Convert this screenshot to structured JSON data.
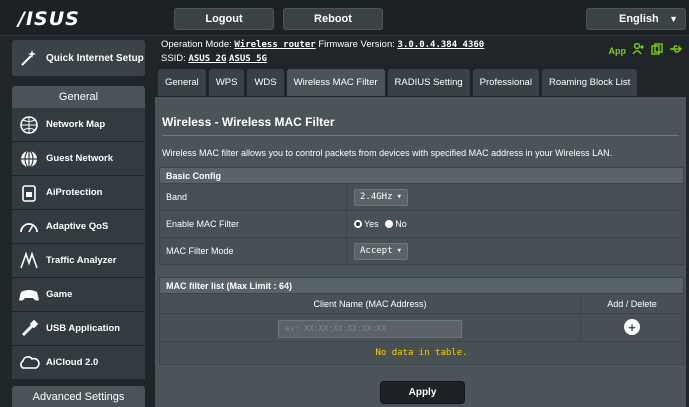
{
  "brand": {
    "logo": "/ISUS"
  },
  "topbar": {
    "logout": "Logout",
    "reboot": "Reboot",
    "language": "English"
  },
  "sidebar": {
    "quick_setup": "Quick Internet Setup",
    "general_header": "General",
    "items": [
      {
        "label": "Network Map",
        "icon": "network-map-icon"
      },
      {
        "label": "Guest Network",
        "icon": "globe-icon"
      },
      {
        "label": "AiProtection",
        "icon": "lock-icon"
      },
      {
        "label": "Adaptive QoS",
        "icon": "gauge-icon"
      },
      {
        "label": "Traffic Analyzer",
        "icon": "traffic-icon"
      },
      {
        "label": "Game",
        "icon": "gamepad-icon"
      },
      {
        "label": "USB Application",
        "icon": "usb-icon"
      },
      {
        "label": "AiCloud 2.0",
        "icon": "cloud-icon"
      }
    ],
    "advanced_header": "Advanced Settings"
  },
  "status": {
    "mode_label": "Operation Mode:",
    "mode_value": "Wireless router",
    "fw_label": "Firmware Version:",
    "fw_value": "3.0.0.4.384_4360",
    "ssid_label": "SSID:",
    "ssid_2g": "ASUS_2G",
    "ssid_5g": "ASUS_5G",
    "app_label": "App"
  },
  "tabs": [
    "General",
    "WPS",
    "WDS",
    "Wireless MAC Filter",
    "RADIUS Setting",
    "Professional",
    "Roaming Block List"
  ],
  "main": {
    "title": "Wireless - Wireless MAC Filter",
    "description": "Wireless MAC filter allows you to control packets from devices with specified MAC address in your Wireless LAN.",
    "basic_config": {
      "header": "Basic Config",
      "band_label": "Band",
      "band_value": "2.4GHz",
      "enable_label": "Enable MAC Filter",
      "yes": "Yes",
      "no": "No",
      "mode_label": "MAC Filter Mode",
      "mode_value": "Accept"
    },
    "mac_list": {
      "header": "MAC filter list (Max Limit : 64)",
      "col_client": "Client Name (MAC Address)",
      "col_action": "Add / Delete",
      "input_placeholder": "ex: XX:XX:XX:XX:XX:XX",
      "no_data": "No data in table."
    },
    "apply": "Apply"
  },
  "colors": {
    "accent_green": "#7bd000",
    "no_data": "#ffcc00"
  }
}
